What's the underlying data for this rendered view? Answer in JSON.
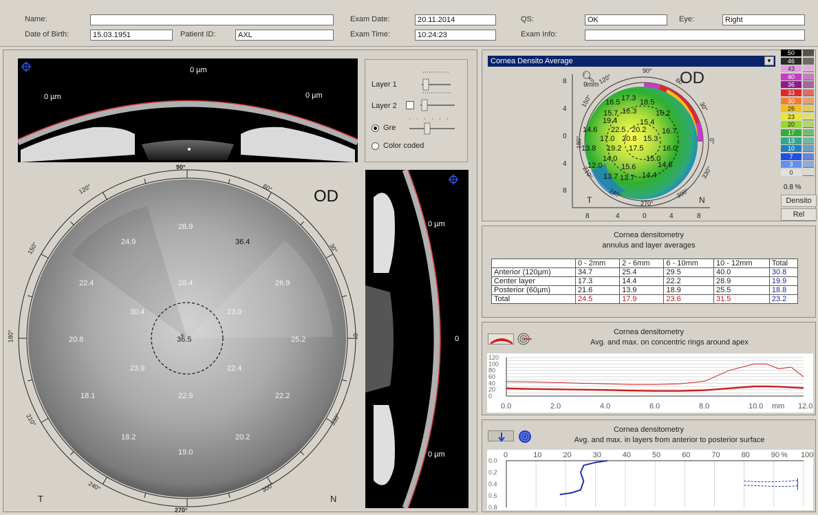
{
  "header": {
    "name_label": "Name:",
    "name_value": "",
    "dob_label": "Date of Birth:",
    "dob_value": "15.03.1951",
    "patient_id_label": "Patient ID:",
    "patient_id_value": "AXL",
    "exam_date_label": "Exam Date:",
    "exam_date_value": "20.11.2014",
    "exam_time_label": "Exam Time:",
    "exam_time_value": "10:24:23",
    "qs_label": "QS:",
    "qs_value": "OK",
    "eye_label": "Eye:",
    "eye_value": "Right",
    "exam_info_label": "Exam Info:",
    "exam_info_value": ""
  },
  "scheimpflug": {
    "label_top": "0 µm",
    "label_left": "0 µm",
    "label_right": "0 µm",
    "vert_top": "0 µm",
    "vert_mid": "0",
    "vert_bottom": "0 µm"
  },
  "layer_controls": {
    "layer1": "Layer 1",
    "layer2": "Layer 2",
    "grey": "Gre",
    "color_coded": "Color coded"
  },
  "dial": {
    "eye": "OD",
    "temporal": "T",
    "nasal": "N",
    "deg_90": "90°",
    "deg_60": "60°",
    "deg_30": "30°",
    "deg_0": "0°",
    "deg_330": "330°",
    "deg_300": "300°",
    "deg_270": "270°",
    "deg_240": "240°",
    "deg_210": "210°",
    "deg_180": "180°",
    "deg_150": "150°",
    "deg_120": "120°",
    "values": [
      {
        "id": "v1",
        "text": "28.9"
      },
      {
        "id": "v2",
        "text": "24.9"
      },
      {
        "id": "v3",
        "text": "36.4"
      },
      {
        "id": "v4",
        "text": "22.4"
      },
      {
        "id": "v5",
        "text": "28.4"
      },
      {
        "id": "v6",
        "text": "26.9"
      },
      {
        "id": "v7",
        "text": "30.4"
      },
      {
        "id": "v8",
        "text": "23.0"
      },
      {
        "id": "v9",
        "text": "20.8"
      },
      {
        "id": "v10",
        "text": "36.5"
      },
      {
        "id": "v11",
        "text": "25.2"
      },
      {
        "id": "v12",
        "text": "23.9"
      },
      {
        "id": "v13",
        "text": "22.4"
      },
      {
        "id": "v14",
        "text": "18.1"
      },
      {
        "id": "v15",
        "text": "22.9"
      },
      {
        "id": "v16",
        "text": "22.2"
      },
      {
        "id": "v17",
        "text": "18.2"
      },
      {
        "id": "v18",
        "text": "20.2"
      },
      {
        "id": "v19",
        "text": "19.0"
      }
    ]
  },
  "map": {
    "selector": "Cornea Densito Average",
    "eye": "OD",
    "zoom": "9mm",
    "temporal": "T",
    "nasal": "N",
    "yticks": [
      "8",
      "4",
      "0",
      "4",
      "8"
    ],
    "xticks": [
      "8",
      "4",
      "0",
      "4",
      "8"
    ],
    "deg_90": "90°",
    "deg_120": "120°",
    "deg_150": "150°",
    "deg_180": "180°",
    "deg_210": "210°",
    "deg_240": "240°",
    "deg_270": "270°",
    "deg_300": "300°",
    "deg_330": "330°",
    "deg_0": "0°",
    "deg_30": "30°",
    "deg_60": "60°",
    "values": [
      "16.5",
      "17.3",
      "18.5",
      "15.7",
      "16.3",
      "16.2",
      "19.4",
      "15.4",
      "14.6",
      "22.5",
      "20.2",
      "16.7",
      "17.0",
      "20.8",
      "15.3",
      "13.8",
      "19.2",
      "17.5",
      "16.0",
      "14.0",
      "15.0",
      "12.0",
      "15.6",
      "14.8",
      "13.7",
      "13.7",
      "14.4"
    ]
  },
  "legend": {
    "values": [
      "50",
      "46",
      "43",
      "40",
      "36",
      "33",
      "30",
      "26",
      "23",
      "20",
      "17",
      "13",
      "10",
      "7",
      "3",
      "0"
    ],
    "colors": [
      "#000000",
      "#2a2a2a",
      "#e0a0e0",
      "#c040c0",
      "#8c1a8c",
      "#e02828",
      "#f08030",
      "#f0c020",
      "#e8e830",
      "#98d830",
      "#30b030",
      "#30a890",
      "#2080c0",
      "#2050e0",
      "#6090f0",
      "#e0e0e0"
    ],
    "percent": "0.8 %",
    "densito": "Densito",
    "rel": "Rel"
  },
  "table_panel": {
    "title1": "Cornea densitometry",
    "title2": "annulus and layer averages",
    "headers": [
      "",
      "0 - 2mm",
      "2 - 6mm",
      "6 - 10mm",
      "10 - 12mm",
      "Total"
    ],
    "rows": [
      [
        "Anterior (120µm)",
        "34.7",
        "25.4",
        "29.5",
        "40.0",
        "30.8"
      ],
      [
        "Center layer",
        "17.3",
        "14.4",
        "22.2",
        "28.9",
        "19.9"
      ],
      [
        "Posterior (60µm)",
        "21.6",
        "13.9",
        "18.9",
        "25.5",
        "18.8"
      ],
      [
        "Total",
        "24.5",
        "17.9",
        "23.6",
        "31.5",
        "23.2"
      ]
    ]
  },
  "rings_panel": {
    "title1": "Cornea densitometry",
    "title2": "Avg. and max. on concentric rings around apex",
    "unit": "mm"
  },
  "layers_panel": {
    "title1": "Cornea densitometry",
    "title2": "Avg. and max. in layers from anterior to posterior surface",
    "unit": "%"
  },
  "chart_data": [
    {
      "type": "line",
      "title": "Cornea densitometry",
      "subtitle": "Avg. and max. on concentric rings around apex",
      "xlabel": "mm",
      "x_ticks": [
        "0.0",
        "2.0",
        "4.0",
        "6.0",
        "8.0",
        "10.0",
        "12.0"
      ],
      "y_ticks": [
        "120",
        "100",
        "80",
        "60",
        "40",
        "20",
        "0"
      ],
      "xlim": [
        0,
        12
      ],
      "ylim": [
        0,
        120
      ],
      "x": [
        0,
        1,
        2,
        3,
        4,
        5,
        6,
        7,
        8,
        9,
        10,
        10.5,
        11,
        11.5,
        12
      ],
      "series": [
        {
          "values": [
            45,
            44,
            42,
            40,
            38,
            36,
            36,
            38,
            46,
            80,
            100,
            100,
            85,
            90,
            60
          ]
        },
        {
          "values": [
            24,
            22,
            21,
            20,
            19,
            17,
            16,
            16,
            18,
            24,
            30,
            30,
            29,
            27,
            25
          ]
        }
      ]
    },
    {
      "type": "line",
      "title": "Cornea densitometry",
      "subtitle": "Avg. and max. in layers from anterior to posterior surface",
      "xlabel": "%",
      "x_ticks": [
        "0",
        "10",
        "20",
        "30",
        "40",
        "50",
        "60",
        "70",
        "80",
        "90",
        "100"
      ],
      "y_ticks": [
        "0.0",
        "0.2",
        "0.4",
        "0.6",
        "0.8"
      ],
      "xlim": [
        0,
        100
      ],
      "ylim": [
        0,
        0.8
      ],
      "series": [
        {
          "points": [
            [
              34,
              0.0
            ],
            [
              30,
              0.03
            ],
            [
              26,
              0.08
            ],
            [
              25,
              0.2
            ],
            [
              26,
              0.35
            ],
            [
              25,
              0.5
            ],
            [
              22,
              0.55
            ],
            [
              18,
              0.58
            ]
          ]
        },
        {
          "points": [
            [
              80,
              0.35
            ],
            [
              85,
              0.36
            ],
            [
              90,
              0.36
            ],
            [
              95,
              0.35
            ],
            [
              98,
              0.34
            ]
          ]
        },
        {
          "points": [
            [
              80,
              0.42
            ],
            [
              85,
              0.43
            ],
            [
              90,
              0.44
            ],
            [
              95,
              0.44
            ],
            [
              98,
              0.43
            ]
          ]
        }
      ]
    }
  ]
}
